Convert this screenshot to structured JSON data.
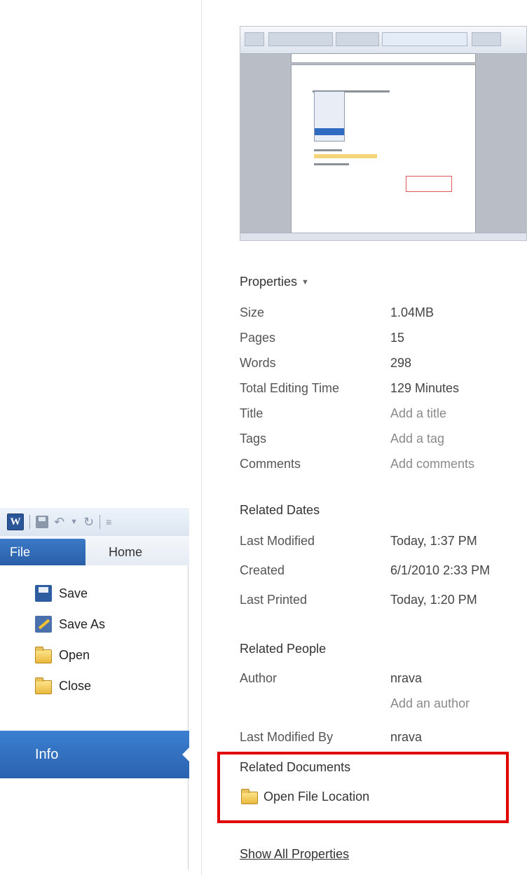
{
  "qat": {
    "app_icon_letter": "W"
  },
  "tabs": {
    "file": "File",
    "home": "Home"
  },
  "backstage_menu": {
    "save": "Save",
    "save_as": "Save As",
    "open": "Open",
    "close": "Close",
    "info": "Info"
  },
  "properties": {
    "title": "Properties",
    "rows": [
      {
        "label": "Size",
        "value": "1.04MB"
      },
      {
        "label": "Pages",
        "value": "15"
      },
      {
        "label": "Words",
        "value": "298"
      },
      {
        "label": "Total Editing Time",
        "value": "129 Minutes"
      },
      {
        "label": "Title",
        "value": "Add a title"
      },
      {
        "label": "Tags",
        "value": "Add a tag"
      },
      {
        "label": "Comments",
        "value": "Add comments"
      }
    ]
  },
  "related_dates": {
    "title": "Related Dates",
    "rows": [
      {
        "label": "Last Modified",
        "value": "Today, 1:37 PM"
      },
      {
        "label": "Created",
        "value": "6/1/2010 2:33 PM"
      },
      {
        "label": "Last Printed",
        "value": "Today, 1:20 PM"
      }
    ]
  },
  "related_people": {
    "title": "Related People",
    "author_label": "Author",
    "author_value": "nrava",
    "add_author": "Add an author",
    "last_modified_by_label": "Last Modified By",
    "last_modified_by_value": "nrava"
  },
  "related_documents": {
    "title": "Related Documents",
    "open_file_location": "Open File Location"
  },
  "show_all_properties": "Show All Properties",
  "colors": {
    "accent_blue": "#2b62b0",
    "highlight_red": "#e00000"
  }
}
